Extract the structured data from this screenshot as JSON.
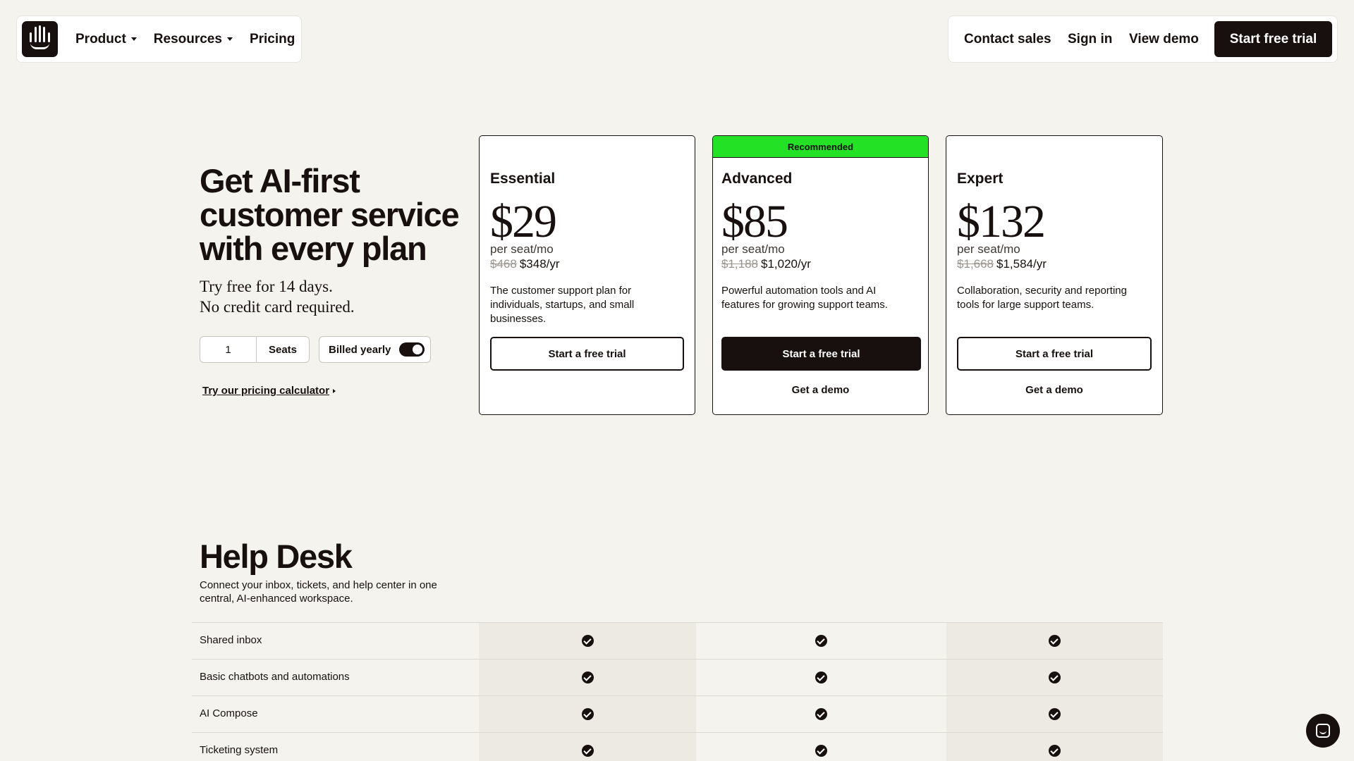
{
  "nav": {
    "product": "Product",
    "resources": "Resources",
    "pricing": "Pricing",
    "contact_sales": "Contact sales",
    "sign_in": "Sign in",
    "view_demo": "View demo",
    "start_trial": "Start free trial"
  },
  "hero": {
    "title": "Get AI-first customer service with every plan",
    "sub_line1": "Try free for 14 days.",
    "sub_line2": "No credit card required.",
    "seats_value": "1",
    "seats_label": "Seats",
    "billing_label": "Billed yearly",
    "billing_yearly_on": true,
    "calculator_link": "Try our pricing calculator"
  },
  "plans": [
    {
      "name": "Essential",
      "price": "$29",
      "per": "per seat/mo",
      "old_yearly": "$468",
      "yearly": "$348/yr",
      "description": "The customer support plan for individuals, startups, and small businesses.",
      "trial_label": "Start a free trial"
    },
    {
      "badge": "Recommended",
      "name": "Advanced",
      "price": "$85",
      "per": "per seat/mo",
      "old_yearly": "$1,188",
      "yearly": "$1,020/yr",
      "description": "Powerful automation tools and AI features for growing support teams.",
      "trial_label": "Start a free trial",
      "demo_label": "Get a demo"
    },
    {
      "name": "Expert",
      "price": "$132",
      "per": "per seat/mo",
      "old_yearly": "$1,668",
      "yearly": "$1,584/yr",
      "description": "Collaboration, security and reporting tools for large support teams.",
      "trial_label": "Start a free trial",
      "demo_label": "Get a demo"
    }
  ],
  "help_desk": {
    "title": "Help Desk",
    "subtitle": "Connect your inbox, tickets, and help center in one central, AI-enhanced workspace.",
    "features": [
      {
        "label": "Shared inbox",
        "included": [
          true,
          true,
          true
        ]
      },
      {
        "label": "Basic chatbots and automations",
        "included": [
          true,
          true,
          true
        ]
      },
      {
        "label": "AI Compose",
        "included": [
          true,
          true,
          true
        ]
      },
      {
        "label": "Ticketing system",
        "included": [
          true,
          true,
          true
        ]
      }
    ]
  },
  "icons": {
    "logo": "intercom-logo-icon",
    "check": "check-circle-icon",
    "chat": "chat-launcher-icon"
  },
  "colors": {
    "background": "#f4f3ee",
    "text": "#17100e",
    "accent_green": "#23e226",
    "column_shade": "#eceae3"
  }
}
